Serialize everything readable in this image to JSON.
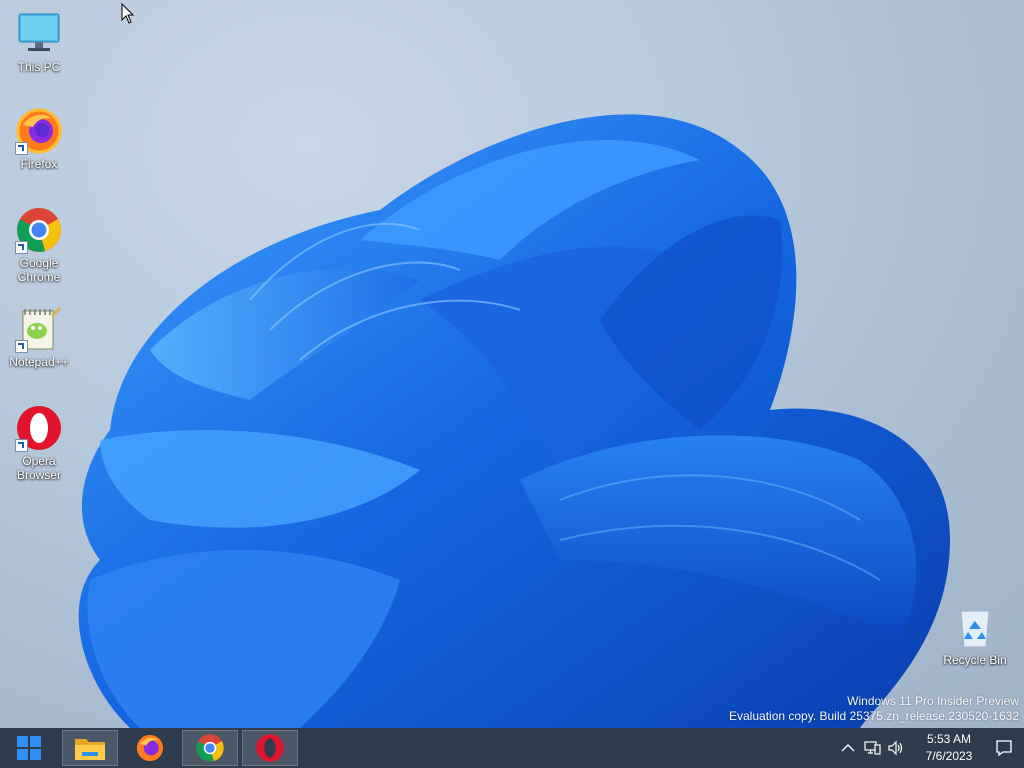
{
  "desktop": {
    "icons": [
      {
        "label": "This PC"
      },
      {
        "label": "Firefox"
      },
      {
        "label": "Google Chrome"
      },
      {
        "label": "Notepad++"
      },
      {
        "label": "Opera Browser"
      },
      {
        "label": "Recycle Bin"
      }
    ],
    "watermark": {
      "line1": "Windows 11 Pro Insider Preview",
      "line2": "Evaluation copy. Build 25375.zn_release.230520-1632"
    }
  },
  "taskbar": {
    "apps": [
      {
        "name": "file-explorer",
        "icon": "folder-icon"
      },
      {
        "name": "firefox",
        "icon": "firefox-icon"
      },
      {
        "name": "chrome",
        "icon": "chrome-icon"
      },
      {
        "name": "opera",
        "icon": "opera-icon"
      }
    ],
    "clock": {
      "time": "5:53 AM",
      "date": "7/6/2023"
    }
  },
  "colors": {
    "taskbar": "#2f3c4e",
    "wallpaper_blue": "#1f6fe8",
    "accent": "#3b8ded"
  }
}
